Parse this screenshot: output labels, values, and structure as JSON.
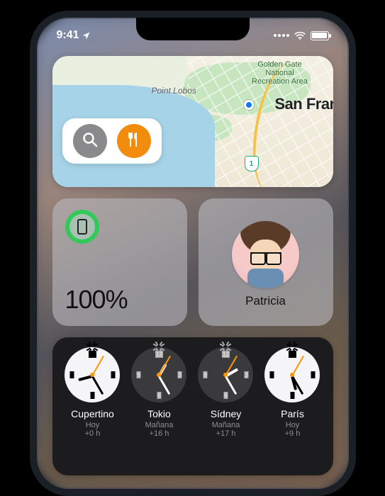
{
  "status": {
    "time": "9:41",
    "location_arrow": "location-arrow-icon",
    "wifi": "wifi-icon",
    "battery": "battery-icon"
  },
  "maps": {
    "park_label": "Golden Gate National Recreation Area",
    "point_label": "Point Lobos",
    "city_label": "San Fran",
    "route_shield": "1",
    "search_icon": "search-icon",
    "food_icon": "fork-knife-icon"
  },
  "battery_widget": {
    "device": "iPhone",
    "percent": "100%"
  },
  "contact_widget": {
    "name": "Patricia"
  },
  "clocks": [
    {
      "city": "Cupertino",
      "day": "Hoy",
      "offset": "+0 h",
      "mode": "day",
      "hour_deg": 255,
      "min_deg": 150,
      "sec_deg": 30
    },
    {
      "city": "Tokio",
      "day": "Mañana",
      "offset": "+16 h",
      "mode": "night",
      "hour_deg": 30,
      "min_deg": 150,
      "sec_deg": 30
    },
    {
      "city": "Sídney",
      "day": "Mañana",
      "offset": "+17 h",
      "mode": "night",
      "hour_deg": 60,
      "min_deg": 150,
      "sec_deg": 30
    },
    {
      "city": "París",
      "day": "Hoy",
      "offset": "+9 h",
      "mode": "day",
      "hour_deg": 165,
      "min_deg": 150,
      "sec_deg": 30
    }
  ]
}
